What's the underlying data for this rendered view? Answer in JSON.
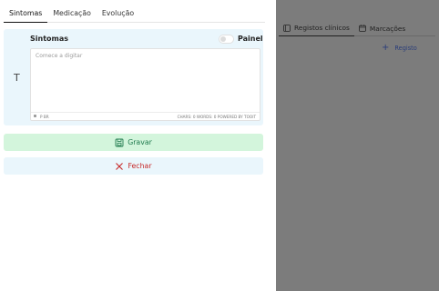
{
  "tabs": [
    {
      "label": "Sintomas",
      "active": true
    },
    {
      "label": "Medicação",
      "active": false
    },
    {
      "label": "Evolução",
      "active": false
    }
  ],
  "card": {
    "letter": "T",
    "title": "Sintomas",
    "panel_toggle_label": "Painel",
    "panel_toggle_on": false
  },
  "editor": {
    "placeholder": "Comece a digitar",
    "path": "P BR",
    "stats": "CHARS: 0  WORDS: 0  POWERED BY TOOIT"
  },
  "actions": {
    "save_label": "Gravar",
    "close_label": "Fechar"
  },
  "side_panel": {
    "tabs": [
      {
        "label": "Registos clínicos",
        "icon": "clinical-records-icon",
        "active": true
      },
      {
        "label": "Marcações",
        "icon": "calendar-icon",
        "active": false
      }
    ],
    "add_label": "Registo"
  },
  "colors": {
    "card_bg": "#eaf6fc",
    "save_bg": "#d3f5dc",
    "save_fg": "#1f7a4d",
    "close_fg": "#c62828",
    "overlay": "#7c7c7c",
    "link": "#2b3e7a"
  }
}
